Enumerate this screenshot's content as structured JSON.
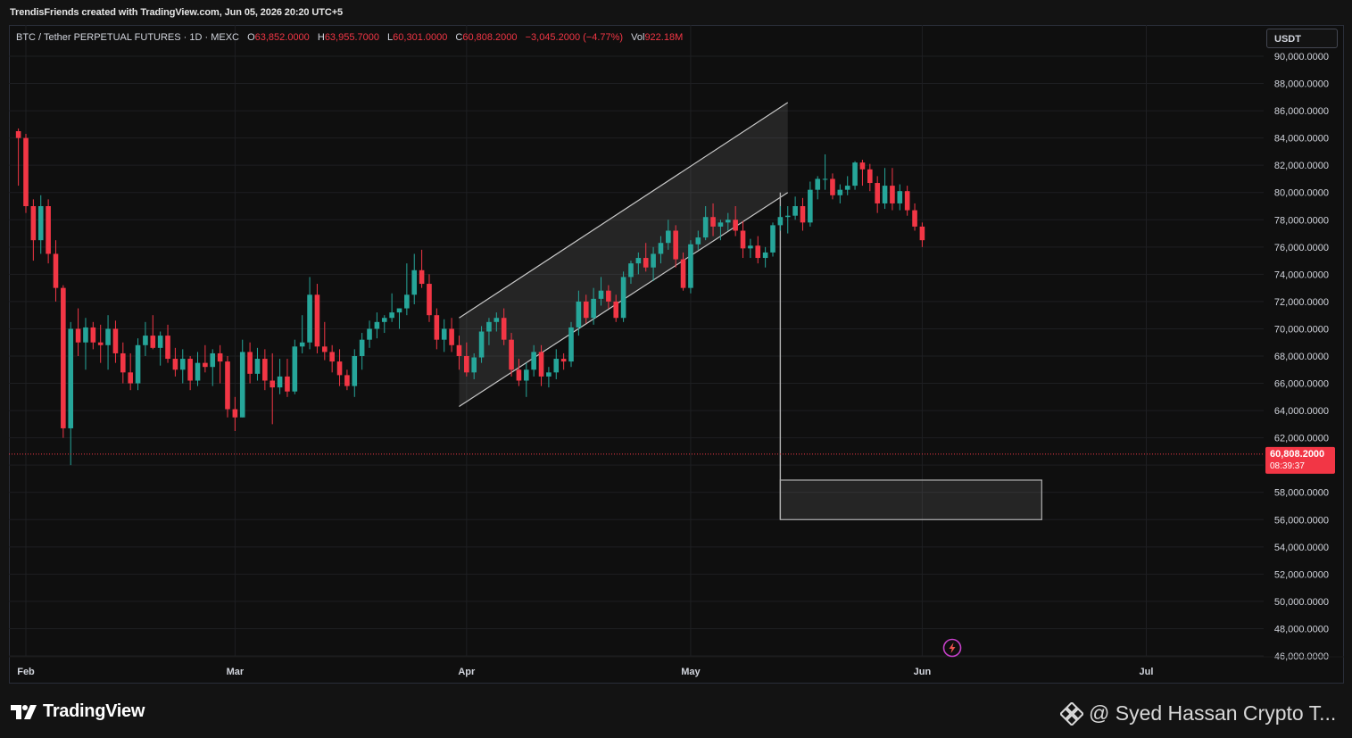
{
  "header": {
    "credit": "TrendisFriends created with TradingView.com, Jun 05, 2026 20:20 UTC+5"
  },
  "legend": {
    "symbol": "BTC / Tether PERPETUAL FUTURES · 1D · MEXC",
    "open_label": "O",
    "open": "63,852.0000",
    "high_label": "H",
    "high": "63,955.7000",
    "low_label": "L",
    "low": "60,301.0000",
    "close_label": "C",
    "close": "60,808.2000",
    "change": "−3,045.2000 (−4.77%)",
    "vol_label": "Vol",
    "vol": "922.18M"
  },
  "currency_button": "USDT",
  "footer": {
    "brand": "TradingView",
    "watermark": "@ Syed Hassan Crypto T..."
  },
  "colors": {
    "up": "#26a69a",
    "down": "#f23645",
    "bg": "#0f0f0f",
    "grid": "#1e1f22",
    "text": "#d1d4dc"
  },
  "icons": {
    "brand_logo": "tradingview-logo",
    "lightning": "lightning-icon",
    "watermark_logo": "diamond-logo-icon"
  },
  "chart_data": {
    "type": "candlestick",
    "interval": "1D",
    "ylim": [
      46000,
      90000
    ],
    "y_ticks": [
      "90,000.0000",
      "88,000.0000",
      "86,000.0000",
      "84,000.0000",
      "82,000.0000",
      "80,000.0000",
      "78,000.0000",
      "76,000.0000",
      "74,000.0000",
      "72,000.0000",
      "70,000.0000",
      "68,000.0000",
      "66,000.0000",
      "64,000.0000",
      "62,000.0000",
      "60,000.0000",
      "58,000.0000",
      "56,000.0000",
      "54,000.0000",
      "52,000.0000",
      "50,000.0000",
      "48,000.0000",
      "46,000.0000"
    ],
    "x_ticks": [
      {
        "label": "Feb",
        "date": "2026-02-01"
      },
      {
        "label": "Mar",
        "date": "2026-03-01"
      },
      {
        "label": "Apr",
        "date": "2026-04-01"
      },
      {
        "label": "May",
        "date": "2026-05-01"
      },
      {
        "label": "Jun",
        "date": "2026-06-01"
      },
      {
        "label": "Jul",
        "date": "2026-07-01"
      }
    ],
    "last_price": {
      "value": 60808.2,
      "label": "60,808.2000",
      "countdown": "08:39:37"
    },
    "candles": [
      {
        "date": "2026-01-31",
        "o": 84500,
        "h": 84700,
        "l": 80500,
        "c": 84000
      },
      {
        "date": "2026-02-01",
        "o": 84000,
        "h": 84300,
        "l": 78500,
        "c": 79000
      },
      {
        "date": "2026-02-02",
        "o": 79000,
        "h": 79500,
        "l": 75000,
        "c": 76500
      },
      {
        "date": "2026-02-03",
        "o": 76500,
        "h": 79800,
        "l": 75500,
        "c": 79000
      },
      {
        "date": "2026-02-04",
        "o": 79000,
        "h": 79500,
        "l": 74800,
        "c": 75500
      },
      {
        "date": "2026-02-05",
        "o": 75500,
        "h": 76500,
        "l": 72000,
        "c": 73000
      },
      {
        "date": "2026-02-06",
        "o": 73000,
        "h": 73200,
        "l": 62000,
        "c": 62700
      },
      {
        "date": "2026-02-07",
        "o": 62700,
        "h": 70500,
        "l": 60000,
        "c": 70000
      },
      {
        "date": "2026-02-08",
        "o": 70000,
        "h": 71500,
        "l": 68000,
        "c": 69000
      },
      {
        "date": "2026-02-09",
        "o": 69000,
        "h": 70800,
        "l": 67000,
        "c": 70100
      },
      {
        "date": "2026-02-10",
        "o": 70100,
        "h": 70500,
        "l": 68500,
        "c": 69000
      },
      {
        "date": "2026-02-11",
        "o": 69000,
        "h": 70300,
        "l": 67500,
        "c": 68800
      },
      {
        "date": "2026-02-12",
        "o": 68800,
        "h": 71000,
        "l": 67000,
        "c": 70000
      },
      {
        "date": "2026-02-13",
        "o": 70000,
        "h": 70600,
        "l": 67500,
        "c": 68200
      },
      {
        "date": "2026-02-14",
        "o": 68200,
        "h": 69000,
        "l": 66000,
        "c": 66800
      },
      {
        "date": "2026-02-15",
        "o": 66800,
        "h": 68200,
        "l": 65500,
        "c": 66000
      },
      {
        "date": "2026-02-16",
        "o": 66000,
        "h": 69300,
        "l": 65500,
        "c": 68800
      },
      {
        "date": "2026-02-17",
        "o": 68800,
        "h": 70500,
        "l": 68000,
        "c": 69500
      },
      {
        "date": "2026-02-18",
        "o": 69500,
        "h": 71000,
        "l": 68500,
        "c": 68600
      },
      {
        "date": "2026-02-19",
        "o": 68600,
        "h": 69800,
        "l": 67300,
        "c": 69500
      },
      {
        "date": "2026-02-20",
        "o": 69500,
        "h": 70300,
        "l": 67500,
        "c": 67800
      },
      {
        "date": "2026-02-21",
        "o": 67800,
        "h": 68600,
        "l": 66500,
        "c": 67000
      },
      {
        "date": "2026-02-22",
        "o": 67000,
        "h": 68500,
        "l": 66000,
        "c": 67800
      },
      {
        "date": "2026-02-23",
        "o": 67800,
        "h": 68000,
        "l": 65500,
        "c": 66200
      },
      {
        "date": "2026-02-24",
        "o": 66200,
        "h": 68300,
        "l": 65800,
        "c": 67500
      },
      {
        "date": "2026-02-25",
        "o": 67500,
        "h": 68800,
        "l": 66800,
        "c": 67200
      },
      {
        "date": "2026-02-26",
        "o": 67200,
        "h": 68500,
        "l": 65800,
        "c": 68200
      },
      {
        "date": "2026-02-27",
        "o": 68200,
        "h": 68800,
        "l": 66000,
        "c": 67600
      },
      {
        "date": "2026-02-28",
        "o": 67600,
        "h": 68000,
        "l": 63500,
        "c": 64100
      },
      {
        "date": "2026-03-01",
        "o": 64100,
        "h": 65000,
        "l": 62500,
        "c": 63500
      },
      {
        "date": "2026-03-02",
        "o": 63500,
        "h": 69200,
        "l": 63500,
        "c": 68300
      },
      {
        "date": "2026-03-03",
        "o": 68300,
        "h": 69000,
        "l": 66000,
        "c": 66700
      },
      {
        "date": "2026-03-04",
        "o": 66700,
        "h": 68600,
        "l": 66200,
        "c": 67800
      },
      {
        "date": "2026-03-05",
        "o": 67800,
        "h": 68500,
        "l": 65500,
        "c": 66200
      },
      {
        "date": "2026-03-06",
        "o": 66200,
        "h": 68200,
        "l": 63000,
        "c": 65700
      },
      {
        "date": "2026-03-07",
        "o": 65700,
        "h": 67800,
        "l": 65200,
        "c": 66500
      },
      {
        "date": "2026-03-08",
        "o": 66500,
        "h": 67800,
        "l": 65000,
        "c": 65400
      },
      {
        "date": "2026-03-09",
        "o": 65400,
        "h": 69200,
        "l": 65200,
        "c": 68700
      },
      {
        "date": "2026-03-10",
        "o": 68700,
        "h": 71000,
        "l": 68200,
        "c": 69000
      },
      {
        "date": "2026-03-11",
        "o": 69000,
        "h": 73800,
        "l": 68500,
        "c": 72500
      },
      {
        "date": "2026-03-12",
        "o": 72500,
        "h": 73300,
        "l": 68200,
        "c": 68700
      },
      {
        "date": "2026-03-13",
        "o": 68700,
        "h": 70500,
        "l": 67700,
        "c": 68300
      },
      {
        "date": "2026-03-14",
        "o": 68300,
        "h": 68800,
        "l": 66800,
        "c": 67600
      },
      {
        "date": "2026-03-15",
        "o": 67600,
        "h": 68500,
        "l": 65800,
        "c": 66600
      },
      {
        "date": "2026-03-16",
        "o": 66600,
        "h": 67000,
        "l": 65500,
        "c": 65800
      },
      {
        "date": "2026-03-17",
        "o": 65800,
        "h": 68500,
        "l": 65000,
        "c": 68000
      },
      {
        "date": "2026-03-18",
        "o": 68000,
        "h": 69700,
        "l": 67000,
        "c": 69200
      },
      {
        "date": "2026-03-19",
        "o": 69200,
        "h": 70600,
        "l": 68600,
        "c": 70000
      },
      {
        "date": "2026-03-20",
        "o": 70000,
        "h": 71200,
        "l": 69300,
        "c": 70500
      },
      {
        "date": "2026-03-21",
        "o": 70500,
        "h": 71000,
        "l": 69700,
        "c": 70800
      },
      {
        "date": "2026-03-22",
        "o": 70800,
        "h": 72600,
        "l": 70500,
        "c": 71200
      },
      {
        "date": "2026-03-23",
        "o": 71200,
        "h": 71500,
        "l": 70000,
        "c": 71500
      },
      {
        "date": "2026-03-24",
        "o": 71500,
        "h": 74800,
        "l": 71000,
        "c": 72500
      },
      {
        "date": "2026-03-25",
        "o": 72500,
        "h": 75500,
        "l": 71800,
        "c": 74300
      },
      {
        "date": "2026-03-26",
        "o": 74300,
        "h": 75800,
        "l": 73000,
        "c": 73300
      },
      {
        "date": "2026-03-27",
        "o": 73300,
        "h": 74000,
        "l": 70500,
        "c": 71000
      },
      {
        "date": "2026-03-28",
        "o": 71000,
        "h": 71500,
        "l": 68500,
        "c": 69200
      },
      {
        "date": "2026-03-29",
        "o": 69200,
        "h": 70700,
        "l": 68300,
        "c": 70000
      },
      {
        "date": "2026-03-30",
        "o": 70000,
        "h": 70800,
        "l": 68300,
        "c": 68800
      },
      {
        "date": "2026-03-31",
        "o": 68800,
        "h": 69500,
        "l": 67000,
        "c": 68000
      },
      {
        "date": "2026-04-01",
        "o": 68000,
        "h": 69000,
        "l": 66500,
        "c": 66800
      },
      {
        "date": "2026-04-02",
        "o": 66800,
        "h": 68200,
        "l": 66300,
        "c": 67900
      },
      {
        "date": "2026-04-03",
        "o": 67900,
        "h": 70200,
        "l": 67500,
        "c": 69800
      },
      {
        "date": "2026-04-04",
        "o": 69800,
        "h": 70800,
        "l": 68800,
        "c": 70500
      },
      {
        "date": "2026-04-05",
        "o": 70500,
        "h": 71200,
        "l": 69800,
        "c": 70800
      },
      {
        "date": "2026-04-06",
        "o": 70800,
        "h": 71500,
        "l": 68800,
        "c": 69200
      },
      {
        "date": "2026-04-07",
        "o": 69200,
        "h": 69700,
        "l": 66500,
        "c": 67000
      },
      {
        "date": "2026-04-08",
        "o": 67000,
        "h": 67800,
        "l": 65800,
        "c": 66200
      },
      {
        "date": "2026-04-09",
        "o": 66200,
        "h": 67500,
        "l": 65000,
        "c": 67000
      },
      {
        "date": "2026-04-10",
        "o": 67000,
        "h": 68800,
        "l": 66500,
        "c": 68300
      },
      {
        "date": "2026-04-11",
        "o": 68300,
        "h": 68800,
        "l": 65800,
        "c": 66500
      },
      {
        "date": "2026-04-12",
        "o": 66500,
        "h": 67200,
        "l": 65700,
        "c": 66800
      },
      {
        "date": "2026-04-13",
        "o": 66800,
        "h": 68500,
        "l": 66300,
        "c": 67800
      },
      {
        "date": "2026-04-14",
        "o": 67800,
        "h": 68200,
        "l": 67000,
        "c": 67600
      },
      {
        "date": "2026-04-15",
        "o": 67600,
        "h": 70500,
        "l": 67200,
        "c": 70100
      },
      {
        "date": "2026-04-16",
        "o": 70100,
        "h": 72800,
        "l": 69500,
        "c": 72000
      },
      {
        "date": "2026-04-17",
        "o": 72000,
        "h": 72500,
        "l": 70400,
        "c": 70800
      },
      {
        "date": "2026-04-18",
        "o": 70800,
        "h": 73000,
        "l": 70300,
        "c": 72200
      },
      {
        "date": "2026-04-19",
        "o": 72200,
        "h": 73800,
        "l": 71700,
        "c": 72800
      },
      {
        "date": "2026-04-20",
        "o": 72800,
        "h": 73200,
        "l": 71500,
        "c": 72000
      },
      {
        "date": "2026-04-21",
        "o": 72000,
        "h": 72500,
        "l": 70500,
        "c": 70800
      },
      {
        "date": "2026-04-22",
        "o": 70800,
        "h": 74200,
        "l": 70500,
        "c": 73800
      },
      {
        "date": "2026-04-23",
        "o": 73800,
        "h": 75000,
        "l": 73300,
        "c": 74800
      },
      {
        "date": "2026-04-24",
        "o": 74800,
        "h": 75600,
        "l": 74000,
        "c": 75200
      },
      {
        "date": "2026-04-25",
        "o": 75200,
        "h": 76300,
        "l": 74200,
        "c": 74500
      },
      {
        "date": "2026-04-26",
        "o": 74500,
        "h": 76000,
        "l": 73500,
        "c": 75500
      },
      {
        "date": "2026-04-27",
        "o": 75500,
        "h": 76800,
        "l": 74800,
        "c": 76300
      },
      {
        "date": "2026-04-28",
        "o": 76300,
        "h": 78000,
        "l": 75800,
        "c": 77200
      },
      {
        "date": "2026-04-29",
        "o": 77200,
        "h": 77600,
        "l": 74500,
        "c": 75100
      },
      {
        "date": "2026-04-30",
        "o": 75100,
        "h": 75600,
        "l": 72800,
        "c": 73000
      },
      {
        "date": "2026-05-01",
        "o": 73000,
        "h": 76500,
        "l": 72600,
        "c": 76200
      },
      {
        "date": "2026-05-02",
        "o": 76200,
        "h": 77200,
        "l": 75800,
        "c": 76700
      },
      {
        "date": "2026-05-03",
        "o": 76700,
        "h": 79000,
        "l": 76500,
        "c": 78200
      },
      {
        "date": "2026-05-04",
        "o": 78200,
        "h": 79200,
        "l": 76800,
        "c": 77500
      },
      {
        "date": "2026-05-05",
        "o": 77500,
        "h": 78000,
        "l": 76500,
        "c": 77800
      },
      {
        "date": "2026-05-06",
        "o": 77800,
        "h": 78500,
        "l": 77200,
        "c": 78000
      },
      {
        "date": "2026-05-07",
        "o": 78000,
        "h": 79000,
        "l": 76800,
        "c": 77200
      },
      {
        "date": "2026-05-08",
        "o": 77200,
        "h": 77900,
        "l": 75200,
        "c": 75900
      },
      {
        "date": "2026-05-09",
        "o": 75900,
        "h": 76600,
        "l": 75200,
        "c": 76100
      },
      {
        "date": "2026-05-10",
        "o": 76100,
        "h": 76800,
        "l": 74800,
        "c": 75200
      },
      {
        "date": "2026-05-11",
        "o": 75200,
        "h": 76000,
        "l": 74500,
        "c": 75600
      },
      {
        "date": "2026-05-12",
        "o": 75600,
        "h": 77800,
        "l": 75300,
        "c": 77600
      },
      {
        "date": "2026-05-13",
        "o": 77600,
        "h": 79000,
        "l": 77200,
        "c": 78200
      },
      {
        "date": "2026-05-14",
        "o": 78200,
        "h": 79000,
        "l": 77000,
        "c": 78300
      },
      {
        "date": "2026-05-15",
        "o": 78300,
        "h": 79700,
        "l": 78000,
        "c": 79000
      },
      {
        "date": "2026-05-16",
        "o": 79000,
        "h": 79600,
        "l": 77200,
        "c": 77800
      },
      {
        "date": "2026-05-17",
        "o": 77800,
        "h": 80800,
        "l": 77500,
        "c": 80200
      },
      {
        "date": "2026-05-18",
        "o": 80200,
        "h": 81200,
        "l": 79500,
        "c": 81000
      },
      {
        "date": "2026-05-19",
        "o": 81000,
        "h": 82800,
        "l": 80200,
        "c": 81000
      },
      {
        "date": "2026-05-20",
        "o": 81000,
        "h": 81400,
        "l": 79500,
        "c": 79800
      },
      {
        "date": "2026-05-21",
        "o": 79800,
        "h": 80600,
        "l": 79200,
        "c": 80200
      },
      {
        "date": "2026-05-22",
        "o": 80200,
        "h": 81200,
        "l": 79800,
        "c": 80500
      },
      {
        "date": "2026-05-23",
        "o": 80500,
        "h": 82300,
        "l": 80200,
        "c": 82200
      },
      {
        "date": "2026-05-24",
        "o": 82200,
        "h": 82400,
        "l": 80500,
        "c": 81700
      },
      {
        "date": "2026-05-25",
        "o": 81700,
        "h": 82100,
        "l": 80100,
        "c": 80700
      },
      {
        "date": "2026-05-26",
        "o": 80700,
        "h": 81200,
        "l": 78500,
        "c": 79200
      },
      {
        "date": "2026-05-27",
        "o": 79200,
        "h": 81800,
        "l": 78800,
        "c": 80500
      },
      {
        "date": "2026-05-28",
        "o": 80500,
        "h": 81800,
        "l": 78700,
        "c": 79200
      },
      {
        "date": "2026-05-29",
        "o": 79200,
        "h": 80600,
        "l": 78700,
        "c": 80100
      },
      {
        "date": "2026-05-30",
        "o": 80100,
        "h": 80500,
        "l": 78300,
        "c": 78700
      },
      {
        "date": "2026-05-31",
        "o": 78700,
        "h": 79200,
        "l": 77200,
        "c": 77500
      },
      {
        "date": "2026-06-01",
        "o": 77500,
        "h": 77800,
        "l": 76000,
        "c": 76500
      }
    ],
    "drawings": {
      "channel": {
        "upper": [
          {
            "date": "2026-03-31",
            "price": 70800
          },
          {
            "date": "2026-05-14",
            "price": 86600
          }
        ],
        "lower": [
          {
            "date": "2026-03-31",
            "price": 64300
          },
          {
            "date": "2026-05-14",
            "price": 80000
          }
        ]
      },
      "projection_line": {
        "date": "2026-05-13",
        "from_price": 80000,
        "to_price": 56000
      },
      "target_box": {
        "date_from": "2026-05-13",
        "date_to": "2026-06-17",
        "price_from": 56000,
        "price_to": 58900
      }
    }
  }
}
